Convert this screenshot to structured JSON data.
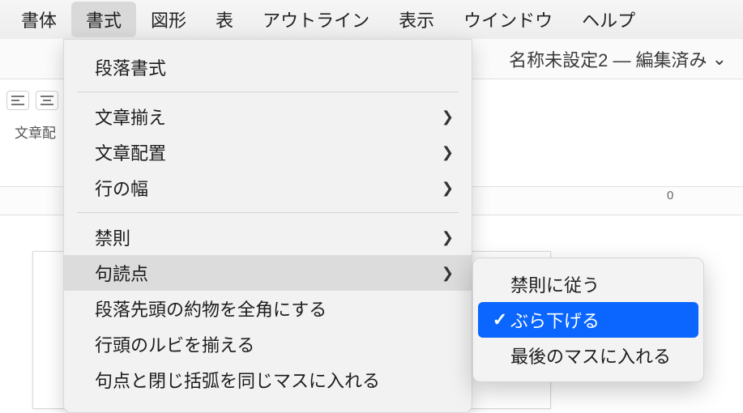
{
  "menubar": {
    "items": [
      "書体",
      "書式",
      "図形",
      "表",
      "アウトライン",
      "表示",
      "ウインドウ",
      "ヘルプ"
    ],
    "active_index": 1
  },
  "window": {
    "title": "名称未設定2 — 編集済み",
    "title_caret": "⌄"
  },
  "toolbar": {
    "label_fragment": "文章配"
  },
  "ruler": {
    "mark0": "0"
  },
  "dropdown": {
    "items": [
      {
        "label": "段落書式",
        "submenu": false
      },
      {
        "sep": true
      },
      {
        "label": "文章揃え",
        "submenu": true
      },
      {
        "label": "文章配置",
        "submenu": true
      },
      {
        "label": "行の幅",
        "submenu": true
      },
      {
        "sep": true
      },
      {
        "label": "禁則",
        "submenu": true
      },
      {
        "label": "句読点",
        "submenu": true,
        "hover": true
      },
      {
        "label": "段落先頭の約物を全角にする",
        "submenu": false
      },
      {
        "label": "行頭のルビを揃える",
        "submenu": false
      },
      {
        "label": "句点と閉じ括弧を同じマスに入れる",
        "submenu": false
      }
    ]
  },
  "submenu": {
    "items": [
      {
        "label": "禁則に従う",
        "checked": false
      },
      {
        "label": "ぶら下げる",
        "checked": true,
        "selected": true
      },
      {
        "label": "最後のマスに入れる",
        "checked": false
      }
    ]
  }
}
